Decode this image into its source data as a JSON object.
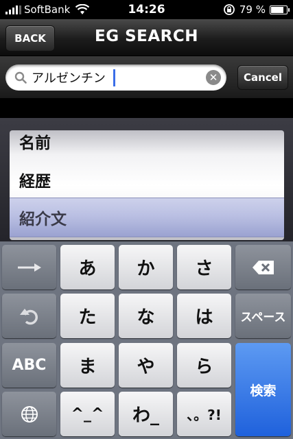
{
  "status": {
    "carrier": "SoftBank",
    "time": "14:26",
    "battery": "79 %"
  },
  "nav": {
    "back": "BACK",
    "title": "EG SEARCH"
  },
  "search": {
    "value": "アルゼンチン",
    "cancel": "Cancel"
  },
  "picker": {
    "items": [
      "名前",
      "経歴",
      "紹介文"
    ],
    "selected_index": 2
  },
  "keyboard": {
    "arrow": "→",
    "backspace": "⌫",
    "undo": "↺",
    "space": "スペース",
    "abc": "ABC",
    "search": "検索",
    "globe": "🌐",
    "rows": [
      [
        "あ",
        "か",
        "さ"
      ],
      [
        "た",
        "な",
        "は"
      ],
      [
        "ま",
        "や",
        "ら"
      ],
      [
        "^_^",
        "わ_",
        "、。?!"
      ]
    ]
  },
  "colors": {
    "accent_blue": "#2f6fe0",
    "caret": "#3a6ee8"
  }
}
